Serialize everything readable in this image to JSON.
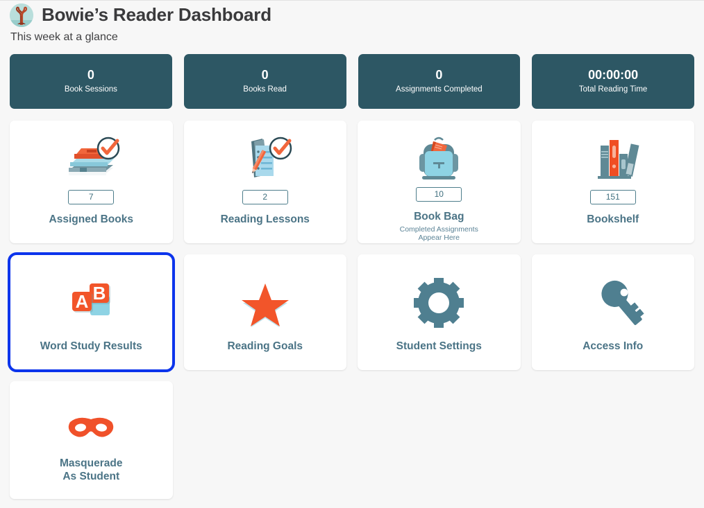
{
  "header": {
    "logo_icon": "tree-logo-icon",
    "title": "Bowie’s Reader Dashboard",
    "subtitle": "This week at a glance"
  },
  "stats": [
    {
      "value": "0",
      "label": "Book Sessions"
    },
    {
      "value": "0",
      "label": "Books Read"
    },
    {
      "value": "0",
      "label": "Assignments Completed"
    },
    {
      "value": "00:00:00",
      "label": "Total Reading Time"
    }
  ],
  "tiles": [
    {
      "icon": "books-stack-check-icon",
      "badge": "7",
      "label": "Assigned Books",
      "sub": ""
    },
    {
      "icon": "lesson-checklist-pencil-icon",
      "badge": "2",
      "label": "Reading Lessons",
      "sub": ""
    },
    {
      "icon": "backpack-icon",
      "badge": "10",
      "label": "Book Bag",
      "sub": "Completed Assignments\nAppear Here"
    },
    {
      "icon": "bookshelf-icon",
      "badge": "151",
      "label": "Bookshelf",
      "sub": ""
    },
    {
      "icon": "ab-letter-blocks-icon",
      "badge": "",
      "label": "Word Study Results",
      "sub": ""
    },
    {
      "icon": "star-icon",
      "badge": "",
      "label": "Reading Goals",
      "sub": ""
    },
    {
      "icon": "gear-icon",
      "badge": "",
      "label": "Student Settings",
      "sub": ""
    },
    {
      "icon": "key-icon",
      "badge": "",
      "label": "Access Info",
      "sub": ""
    },
    {
      "icon": "mask-icon",
      "badge": "",
      "label": "Masquerade\nAs Student",
      "sub": ""
    }
  ],
  "colors": {
    "stat_card_bg": "#2d5764",
    "tile_label": "#4b7486",
    "accent_orange": "#f05a28",
    "accent_blue": "#82cfe0",
    "focus_ring": "#0c34ec",
    "page_bg": "#f7f7f7"
  }
}
